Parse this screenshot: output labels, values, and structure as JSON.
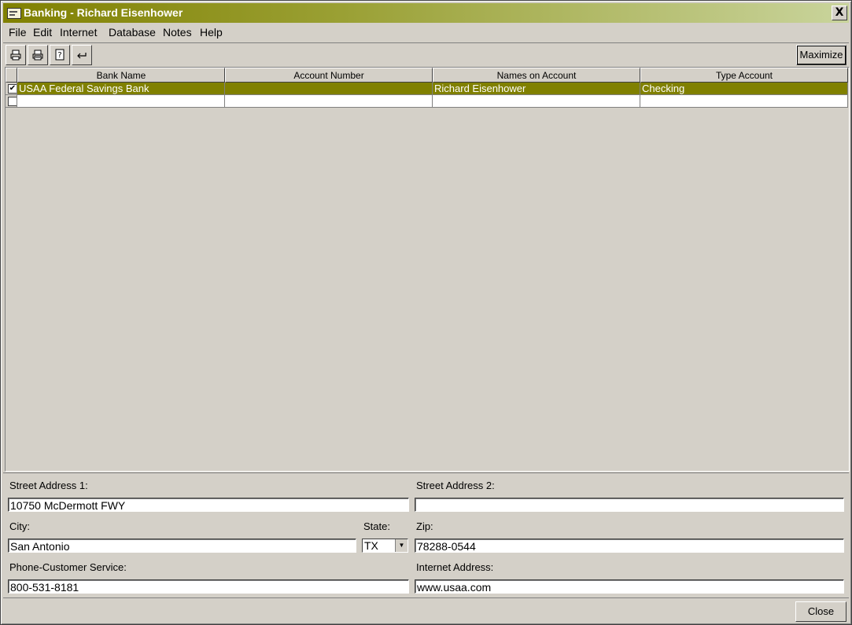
{
  "window": {
    "title": "Banking - Richard Eisenhower",
    "close_glyph": "X"
  },
  "menu": [
    "File",
    "Edit",
    "Internet",
    "Database",
    "Notes",
    "Help"
  ],
  "toolbar": {
    "icons": [
      "print-icon",
      "print-preview-icon",
      "help-icon",
      "back-arrow-icon"
    ],
    "maximize_label": "Maximize"
  },
  "grid": {
    "columns": [
      "Bank Name",
      "Account Number",
      "Names on Account",
      "Type Account"
    ],
    "rows": [
      {
        "checked": true,
        "bank_name": "USAA Federal Savings Bank",
        "account_number": "",
        "names_on_account": "Richard Eisenhower",
        "type_account": "Checking",
        "selected": true
      },
      {
        "checked": false,
        "bank_name": "",
        "account_number": "",
        "names_on_account": "",
        "type_account": "",
        "selected": false
      }
    ]
  },
  "details": {
    "street1_label": "Street Address 1:",
    "street1_value": "10750 McDermott FWY",
    "street2_label": "Street Address 2:",
    "street2_value": "",
    "city_label": "City:",
    "city_value": "San Antonio",
    "state_label": "State:",
    "state_value": "TX",
    "zip_label": "Zip:",
    "zip_value": "78288-0544",
    "phone_label": "Phone-Customer Service:",
    "phone_value": "800-531-8181",
    "internet_label": "Internet Address:",
    "internet_value": "www.usaa.com"
  },
  "footer": {
    "close_label": "Close"
  },
  "colors": {
    "accent": "#808000",
    "face": "#d4d0c8"
  }
}
